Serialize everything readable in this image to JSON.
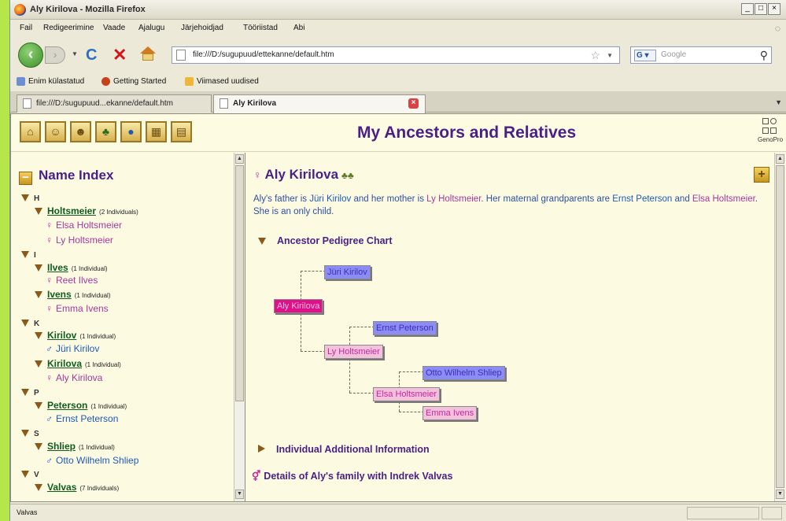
{
  "window": {
    "title": "Aly Kirilova - Mozilla Firefox",
    "min": "_",
    "max": "□",
    "close": "×"
  },
  "menu": [
    "Fail",
    "Redigeerimine",
    "Vaade",
    "Ajalugu",
    "Järjehoidjad",
    "Tööriistad",
    "Abi"
  ],
  "nav": {
    "url": "file:///D:/sugupuud/ettekanne/default.htm",
    "search_engine": "G",
    "search_placeholder": "Google"
  },
  "bookmarks": [
    "Enim külastatud",
    "Getting Started",
    "Viimased uudised"
  ],
  "tabs": [
    {
      "label": "file:///D:/sugupuud...ekanne/default.htm"
    },
    {
      "label": "Aly Kirilova"
    }
  ],
  "site": {
    "title": "My Ancestors and Relatives",
    "logo_text": "GenoPro"
  },
  "name_index": {
    "heading": "Name Index",
    "rows": [
      {
        "kind": "letter",
        "text": "H"
      },
      {
        "kind": "surname",
        "text": "Holtsmeier",
        "count": "(2 Individuals)"
      },
      {
        "kind": "female",
        "text": "Elsa Holtsmeier"
      },
      {
        "kind": "female",
        "text": "Ly Holtsmeier"
      },
      {
        "kind": "letter",
        "text": "I"
      },
      {
        "kind": "surname",
        "text": "Ilves",
        "count": "(1 Individual)"
      },
      {
        "kind": "female",
        "text": "Reet Ilves"
      },
      {
        "kind": "surname",
        "text": "Ivens",
        "count": "(1 Individual)"
      },
      {
        "kind": "female",
        "text": "Emma Ivens"
      },
      {
        "kind": "letter",
        "text": "K"
      },
      {
        "kind": "surname",
        "text": "Kirilov",
        "count": "(1 Individual)"
      },
      {
        "kind": "male",
        "text": "Jüri Kirilov"
      },
      {
        "kind": "surname",
        "text": "Kirilova",
        "count": "(1 Individual)"
      },
      {
        "kind": "female",
        "text": "Aly Kirilova"
      },
      {
        "kind": "letter",
        "text": "P"
      },
      {
        "kind": "surname",
        "text": "Peterson",
        "count": "(1 Individual)"
      },
      {
        "kind": "male",
        "text": "Ernst Peterson"
      },
      {
        "kind": "letter",
        "text": "S"
      },
      {
        "kind": "surname",
        "text": "Shliep",
        "count": "(1 Individual)"
      },
      {
        "kind": "male",
        "text": "Otto Wilhelm Shliep"
      },
      {
        "kind": "letter",
        "text": "V"
      },
      {
        "kind": "surname",
        "text": "Valvas",
        "count": "(7 Individuals)"
      }
    ]
  },
  "person": {
    "name": "Aly Kirilova",
    "bio": {
      "p1": "Aly's father is ",
      "father": "Jüri Kirilov",
      "p2": " and her mother is ",
      "mother": "Ly Holtsmeier",
      "p3": ".  Her maternal grandparents are ",
      "gf": "Ernst Peterson",
      "p4": " and ",
      "gm": "Elsa Holtsmeier",
      "p5": ".  She is an only child."
    },
    "sections": {
      "pedigree": "Ancestor Pedigree Chart",
      "additional": "Individual Additional Information",
      "family": "Details of Aly's family with Indrek Valvas"
    },
    "pedigree": {
      "self": "Aly Kirilova",
      "father": "Jüri Kirilov",
      "mother": "Ly Holtsmeier",
      "mgf": "Ernst Peterson",
      "mgm": "Elsa Holtsmeier",
      "mggf": "Otto Wilhelm Shliep",
      "mggm": "Emma Ivens"
    }
  },
  "status": "Valvas"
}
